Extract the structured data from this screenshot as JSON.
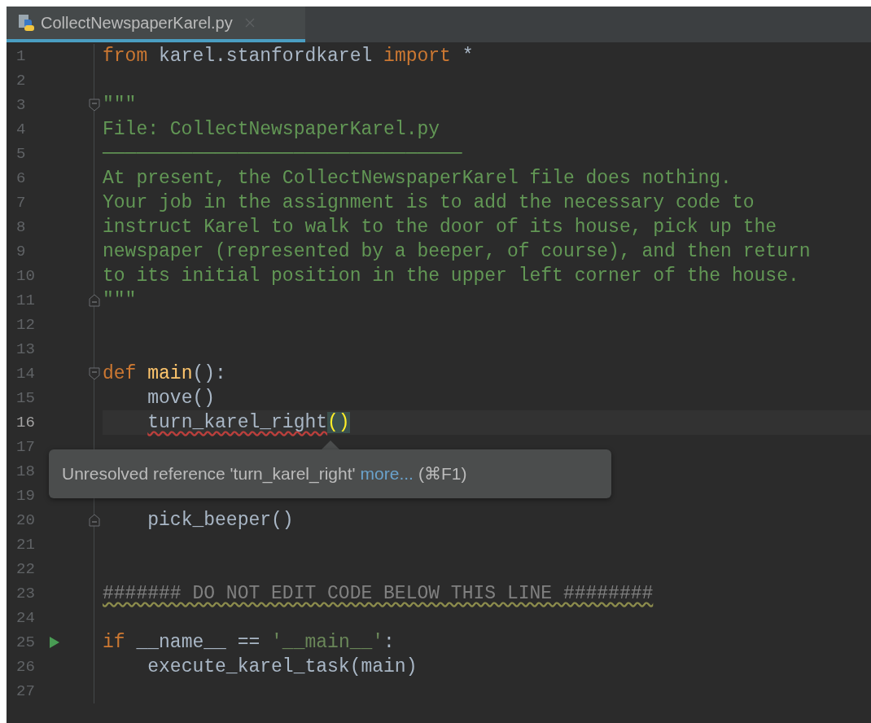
{
  "tab": {
    "label": "CollectNewspaperKarel.py",
    "selected": true
  },
  "lines": [
    {
      "number": "1",
      "tokens": [
        {
          "kind": "keyword",
          "text": "from"
        },
        {
          "kind": "plain",
          "text": " karel.stanfordkarel "
        },
        {
          "kind": "keyword",
          "text": "import"
        },
        {
          "kind": "plain",
          "text": " *"
        }
      ]
    },
    {
      "number": "2"
    },
    {
      "number": "3",
      "fold_start": true,
      "tokens": [
        {
          "kind": "doc",
          "text": "\"\"\""
        }
      ]
    },
    {
      "number": "4",
      "tokens": [
        {
          "kind": "doc",
          "text": "File: CollectNewspaperKarel.py"
        }
      ]
    },
    {
      "number": "5",
      "tokens": [
        {
          "kind": "doc",
          "text": "────────────────────────────────"
        }
      ]
    },
    {
      "number": "6",
      "tokens": [
        {
          "kind": "doc",
          "text": "At present, the CollectNewspaperKarel file does nothing."
        }
      ]
    },
    {
      "number": "7",
      "tokens": [
        {
          "kind": "doc",
          "text": "Your job in the assignment is to add the necessary code to"
        }
      ]
    },
    {
      "number": "8",
      "tokens": [
        {
          "kind": "doc",
          "text": "instruct Karel to walk to the door of its house, pick up the"
        }
      ]
    },
    {
      "number": "9",
      "tokens": [
        {
          "kind": "doc",
          "text": "newspaper (represented by a beeper, of course), and then return"
        }
      ]
    },
    {
      "number": "10",
      "tokens": [
        {
          "kind": "doc",
          "text": "to its initial position in the upper left corner of the house."
        }
      ]
    },
    {
      "number": "11",
      "fold_end": true,
      "tokens": [
        {
          "kind": "doc",
          "text": "\"\"\""
        }
      ]
    },
    {
      "number": "12"
    },
    {
      "number": "13"
    },
    {
      "number": "14",
      "fold_start": true,
      "tokens": [
        {
          "kind": "keyword",
          "text": "def"
        },
        {
          "kind": "defname",
          "text": " main"
        },
        {
          "kind": "plain",
          "text": "():"
        }
      ]
    },
    {
      "number": "15",
      "tokens": [
        {
          "kind": "plain",
          "text": "    move()"
        }
      ]
    },
    {
      "number": "16",
      "current": true,
      "tokens": [
        {
          "kind": "plain",
          "text": "    turn_karel_right",
          "error": true
        },
        {
          "kind": "match",
          "text": "()"
        }
      ]
    },
    {
      "number": "17"
    },
    {
      "number": "18"
    },
    {
      "number": "19"
    },
    {
      "number": "20",
      "fold_end": true,
      "tokens": [
        {
          "kind": "plain",
          "text": "    pick_beeper()"
        }
      ]
    },
    {
      "number": "21"
    },
    {
      "number": "22"
    },
    {
      "number": "23",
      "tokens": [
        {
          "kind": "comment",
          "text": "####### DO NOT EDIT CODE BELOW THIS LINE ########",
          "warning": true
        }
      ]
    },
    {
      "number": "24"
    },
    {
      "number": "25",
      "runnable": true,
      "tokens": [
        {
          "kind": "keyword",
          "text": "if"
        },
        {
          "kind": "plain",
          "text": " __name__ == "
        },
        {
          "kind": "string",
          "text": "'__main__'"
        },
        {
          "kind": "plain",
          "text": ":"
        }
      ]
    },
    {
      "number": "26",
      "tokens": [
        {
          "kind": "plain",
          "text": "    execute_karel_task(main)"
        }
      ]
    },
    {
      "number": "27"
    }
  ],
  "tooltip": {
    "message": "Unresolved reference 'turn_karel_right'",
    "link": "more...",
    "shortcut": "(⌘F1)"
  }
}
